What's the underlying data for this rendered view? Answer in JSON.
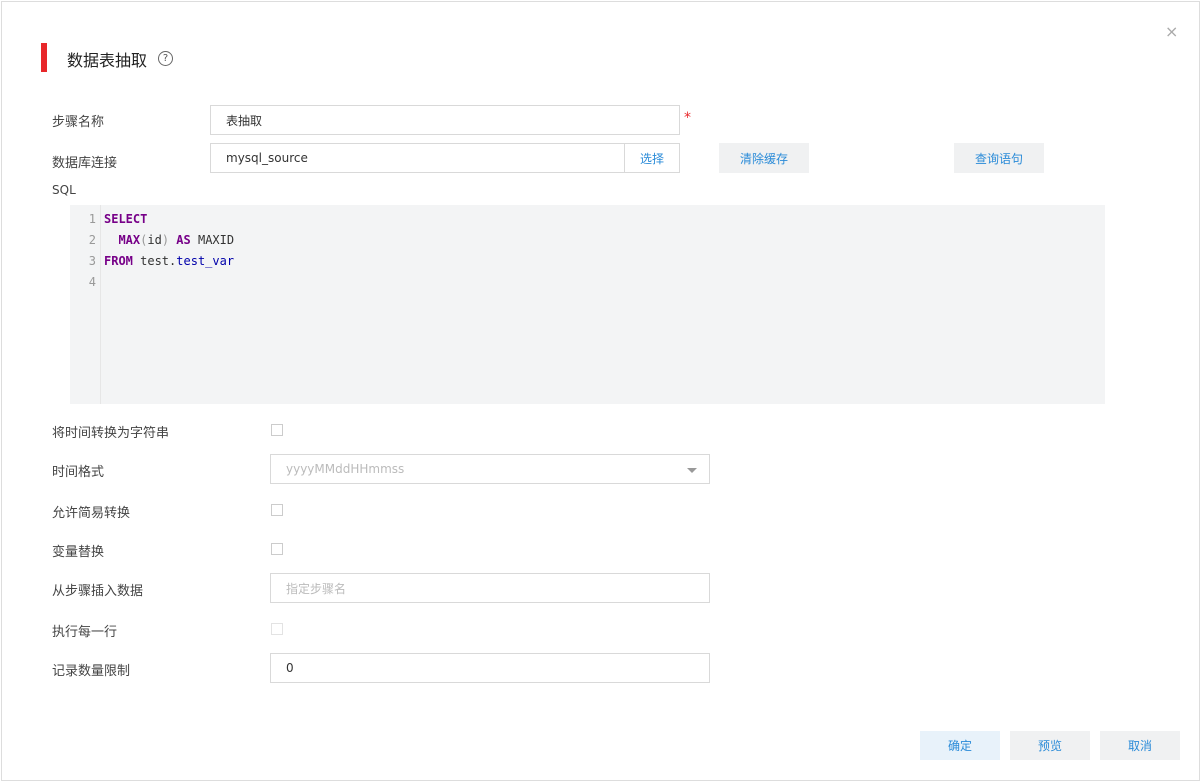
{
  "dialog": {
    "title": "数据表抽取",
    "help_glyph": "?",
    "close_glyph": "×"
  },
  "form": {
    "step_name": {
      "label": "步骤名称",
      "value": "表抽取",
      "required_mark": "*"
    },
    "db_connection": {
      "label": "数据库连接",
      "value": "mysql_source",
      "select_label": "选择"
    },
    "clear_cache_label": "清除缓存",
    "query_statement_label": "查询语句",
    "sql_label": "SQL",
    "sql_lines": [
      {
        "num": "1",
        "parts": [
          {
            "t": "SELECT",
            "c": "kw"
          }
        ]
      },
      {
        "num": "2",
        "parts": [
          {
            "t": "  ",
            "c": ""
          },
          {
            "t": "MAX",
            "c": "kw"
          },
          {
            "t": "(",
            "c": "paren"
          },
          {
            "t": "id",
            "c": ""
          },
          {
            "t": ")",
            "c": "paren"
          },
          {
            "t": " ",
            "c": ""
          },
          {
            "t": "AS",
            "c": "kw"
          },
          {
            "t": " MAXID",
            "c": ""
          }
        ]
      },
      {
        "num": "3",
        "parts": [
          {
            "t": "FROM",
            "c": "kw"
          },
          {
            "t": " test.",
            "c": ""
          },
          {
            "t": "test_var",
            "c": "var"
          }
        ]
      },
      {
        "num": "4",
        "parts": []
      }
    ],
    "time_to_string": {
      "label": "将时间转换为字符串",
      "checked": false
    },
    "time_format": {
      "label": "时间格式",
      "value": "yyyyMMddHHmmss"
    },
    "lazy_conversion": {
      "label": "允许简易转换",
      "checked": false
    },
    "variable_replace": {
      "label": "变量替换",
      "checked": false
    },
    "insert_from_step": {
      "label": "从步骤插入数据",
      "placeholder": "指定步骤名"
    },
    "execute_each_row": {
      "label": "执行每一行",
      "checked": false,
      "disabled": true
    },
    "row_limit": {
      "label": "记录数量限制",
      "value": "0"
    }
  },
  "footer": {
    "confirm_label": "确定",
    "preview_label": "预览",
    "cancel_label": "取消"
  }
}
